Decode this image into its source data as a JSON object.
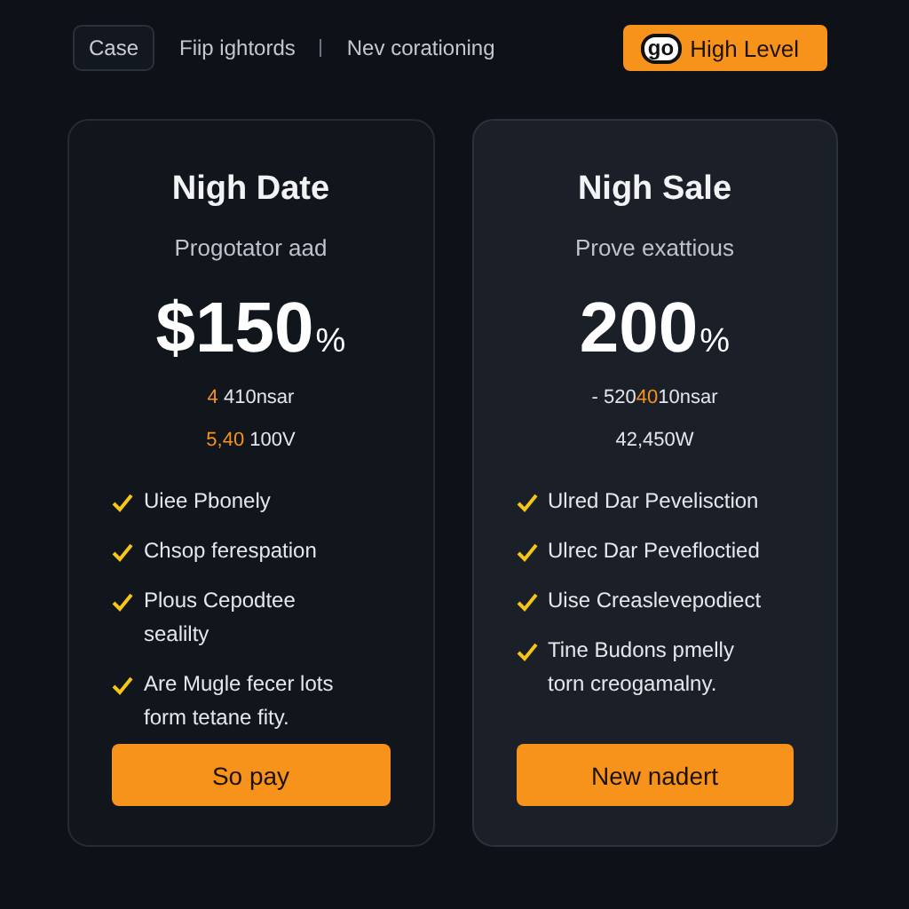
{
  "nav": {
    "pill": "Case",
    "links": [
      "Fiip ightords",
      "Nev corationing"
    ],
    "cta": {
      "badge": "go",
      "label": "High Level"
    }
  },
  "plans": [
    {
      "title": "Nigh Date",
      "subtitle": "Progotator aad",
      "price": "$150",
      "price_unit": "%",
      "highlighted": false,
      "lines": [
        [
          {
            "text": "4",
            "accent": true
          },
          {
            "text": " 410nsar",
            "accent": false
          }
        ],
        [
          {
            "text": "5,40",
            "accent": true
          },
          {
            "text": " 100V",
            "accent": false
          }
        ]
      ],
      "features": [
        "Uiee Pbonely",
        "Chsop ferespation",
        "Plous Cepodtee sealilty",
        "Are Mugle fecer lots form tetane fity."
      ],
      "button": "So pay"
    },
    {
      "title": "Nigh Sale",
      "subtitle": "Prove exattious",
      "price": "200",
      "price_unit": "%",
      "highlighted": true,
      "lines": [
        [
          {
            "text": "- 520",
            "accent": false
          },
          {
            "text": "40",
            "accent": true
          },
          {
            "text": "10nsar",
            "accent": false
          }
        ],
        [
          {
            "text": "42,450W",
            "accent": false
          }
        ]
      ],
      "features": [
        "Ulred Dar Pevelisction",
        "Ulrec Dar Pevefloctied",
        "Uise Creaslevepodiect",
        "Tine Budons pmelly torn creogamalny."
      ],
      "button": "New nadert"
    }
  ]
}
